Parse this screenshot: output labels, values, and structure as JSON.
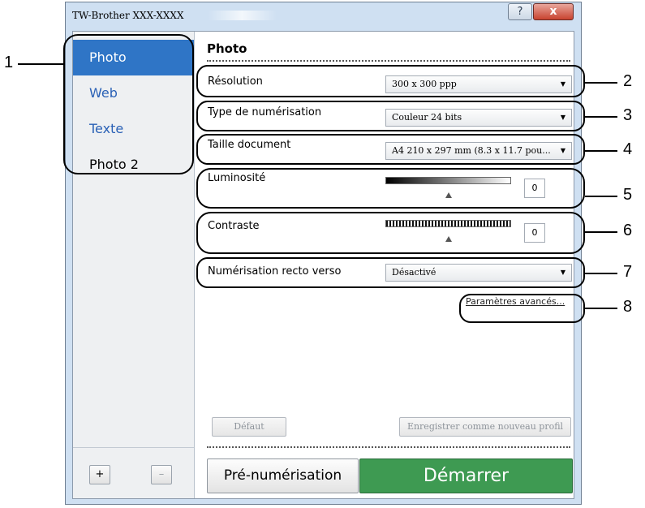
{
  "window": {
    "title": "TW-Brother XXX-XXXX",
    "help_label": "?",
    "close_label": "x"
  },
  "sidebar": {
    "profiles": [
      {
        "label": "Photo",
        "selected": true
      },
      {
        "label": "Web"
      },
      {
        "label": "Texte"
      },
      {
        "label": "Photo 2"
      }
    ],
    "add_label": "+",
    "remove_label": "–"
  },
  "main": {
    "title": "Photo",
    "resolution": {
      "label": "Résolution",
      "value": "300 x 300 ppp"
    },
    "scan_type": {
      "label": "Type de numérisation",
      "value": "Couleur 24 bits"
    },
    "doc_size": {
      "label": "Taille document",
      "value": "A4 210 x 297 mm (8.3 x 11.7 pou..."
    },
    "brightness": {
      "label": "Luminosité",
      "value": "0"
    },
    "contrast": {
      "label": "Contraste",
      "value": "0"
    },
    "duplex": {
      "label": "Numérisation recto verso",
      "value": "Désactivé"
    },
    "advanced_link": "Paramètres avancés...",
    "default_button": "Défaut",
    "save_profile_button": "Enregistrer comme nouveau profil",
    "prescan_button": "Pré-numérisation",
    "start_button": "Démarrer"
  },
  "callouts": [
    "1",
    "2",
    "3",
    "4",
    "5",
    "6",
    "7",
    "8"
  ],
  "colors": {
    "selected_profile": "#2f75c6",
    "link": "#2a61b6",
    "start_button": "#3e9a52"
  }
}
